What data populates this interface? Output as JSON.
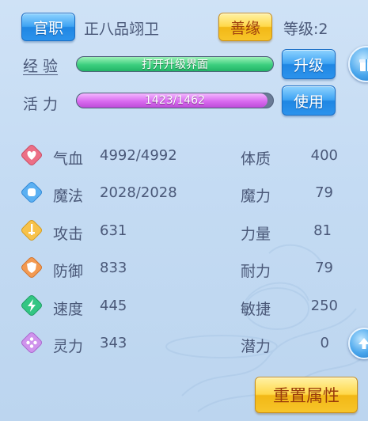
{
  "header": {
    "title_badge": "官职",
    "rank": "正八品翊卫",
    "karma_button": "善缘",
    "level_label": "等级:2"
  },
  "experience": {
    "label": "经 验",
    "bar_text": "打开升级界面",
    "fill_fraction": 1.0,
    "button": "升级"
  },
  "vitality": {
    "label": "活 力",
    "bar_text": "1423/1462",
    "fill_fraction": 0.973,
    "button": "使用"
  },
  "stats_left": [
    {
      "icon": "heart-icon",
      "label": "气血",
      "value": "4992/4992",
      "color": "#e8617a"
    },
    {
      "icon": "mana-icon",
      "label": "魔法",
      "value": "2028/2028",
      "color": "#4aa3f0"
    },
    {
      "icon": "sword-icon",
      "label": "攻击",
      "value": "631",
      "color": "#f5b73c"
    },
    {
      "icon": "shield-icon",
      "label": "防御",
      "value": "833",
      "color": "#f08a3c"
    },
    {
      "icon": "speed-icon",
      "label": "速度",
      "value": "445",
      "color": "#2fbf7a"
    },
    {
      "icon": "spirit-icon",
      "label": "灵力",
      "value": "343",
      "color": "#c98be8"
    }
  ],
  "stats_right": [
    {
      "label": "体质",
      "value": "400"
    },
    {
      "label": "魔力",
      "value": "79"
    },
    {
      "label": "力量",
      "value": "81"
    },
    {
      "label": "耐力",
      "value": "79"
    },
    {
      "label": "敏捷",
      "value": "250"
    },
    {
      "label": "潜力",
      "value": "0"
    }
  ],
  "reset_button": "重置属性",
  "side_icons": [
    "gift-icon",
    "arrow-up-icon"
  ]
}
